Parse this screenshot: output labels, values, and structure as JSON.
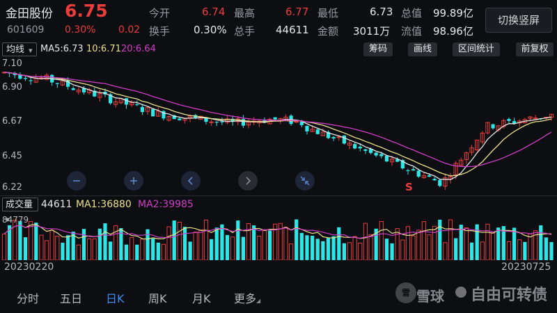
{
  "header": {
    "stock_name": "金田股份",
    "price": "6.75",
    "code": "601609",
    "change_pct": "0.30%",
    "change_amt": "0.02",
    "open_label": "今开",
    "open_value": "6.74",
    "high_label": "最高",
    "high_value": "6.77",
    "low_label": "最低",
    "low_value": "6.73",
    "total_cap_label": "总值",
    "total_cap_value": "99.89亿",
    "turnover_label": "换手",
    "turnover_value": "0.30%",
    "volume_label": "总手",
    "volume_value": "44611",
    "amount_label": "金额",
    "amount_value": "3011万",
    "float_cap_label": "流值",
    "float_cap_value": "98.96亿",
    "switch_button": "切换竖屏"
  },
  "toolbar": {
    "ma_select": "均线",
    "ma5": "MA5:6.73",
    "ma10": "10:6.71",
    "ma20": "20:6.64",
    "chips_button": "筹码",
    "draw_button": "画线",
    "range_button": "区间统计",
    "adjust_button": "前复权"
  },
  "price_axis": [
    "7.10",
    "6.90",
    "6.67",
    "6.45",
    "6.22"
  ],
  "volume_bar": {
    "indicator_select": "成交量",
    "vol": "44611",
    "ma1": "MA1:36880",
    "ma2": "MA2:39985",
    "max_label": "84779"
  },
  "dates": {
    "start": "20230220",
    "end": "20230725"
  },
  "marker": "S",
  "tabs": [
    "分时",
    "五日",
    "日K",
    "周K",
    "月K",
    "更多"
  ],
  "active_tab": "日K",
  "watermark": {
    "brand": "雪球",
    "text": "自由可转债"
  },
  "colors": {
    "up": "#ec3d3d",
    "down": "#2ee6e6",
    "ma5": "#e8e8e8",
    "ma10": "#ece28a",
    "ma20": "#d23ec8",
    "accent": "#3d8bf5"
  }
}
